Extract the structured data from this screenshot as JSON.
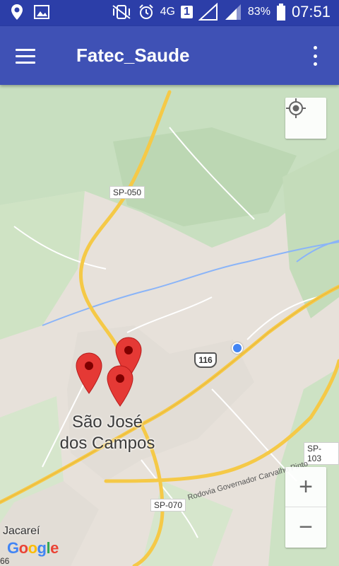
{
  "status_bar": {
    "network": "4G",
    "sim": "1",
    "battery": "83%",
    "time": "07:51"
  },
  "app_bar": {
    "title": "Fatec_Saude"
  },
  "map": {
    "city_name": "São José dos Campos",
    "town_label": "Jacareí",
    "road_labels": {
      "sp050": "SP-050",
      "br116": "116",
      "sp103": "SP-103",
      "sp070": "SP-070",
      "rodovia": "Rodovia Governador Carvalho Pinto"
    },
    "corner_number": "66",
    "attribution": "Google",
    "zoom_in_label": "+",
    "zoom_out_label": "−",
    "marker_count": 3,
    "colors": {
      "app_bar": "#3f51b5",
      "status_bar": "#2c3ea8",
      "marker": "#e53935",
      "location_dot": "#4285f4"
    }
  }
}
